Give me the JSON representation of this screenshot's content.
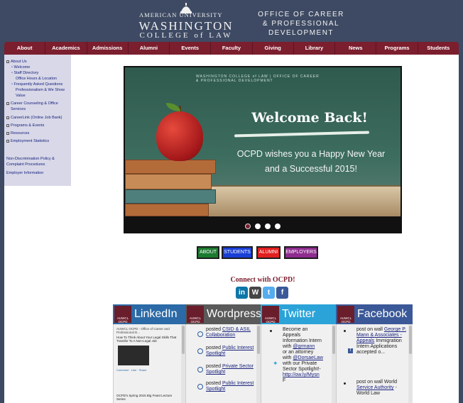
{
  "header": {
    "logo_line1": "AMERICAN UNIVERSITY",
    "logo_line2": "WASHINGTON",
    "logo_line3": "COLLEGE of LAW",
    "office_line1": "OFFICE OF CAREER",
    "office_line2": "& PROFESSIONAL",
    "office_line3": "DEVELOPMENT"
  },
  "nav": [
    "About",
    "Academics",
    "Admissions",
    "Alumni",
    "Events",
    "Faculty",
    "Giving",
    "Library",
    "News",
    "Programs",
    "Students"
  ],
  "sidebar": {
    "items": [
      {
        "label": "About Us"
      },
      {
        "label": "Welcome"
      },
      {
        "label": "Staff Directory"
      },
      {
        "label": "Office Hours & Location"
      },
      {
        "label": "Frequently Asked Questions"
      },
      {
        "label": "Professionalism & We Show"
      },
      {
        "label": "Value"
      },
      {
        "label": "Career Counseling & Office"
      },
      {
        "label": "Services"
      },
      {
        "label": "CareerLink (Online Job Bank)"
      },
      {
        "label": "Programs & Events"
      },
      {
        "label": "Resources"
      },
      {
        "label": "Employment Statistics"
      },
      {
        "label": "Non-Discrimination Policy &"
      },
      {
        "label": "Complaint Procedures"
      },
      {
        "label": "Employer Information"
      }
    ]
  },
  "slider": {
    "mini_logo": "WASHINGTON COLLEGE of LAW  |  OFFICE OF CAREER & PROFESSIONAL DEVELOPMENT",
    "headline": "Welcome Back!",
    "message_line1": "OCPD wishes you a Happy New Year",
    "message_line2": "and a Successful 2015!",
    "active_index": 0,
    "dot_count": 4
  },
  "audience": [
    {
      "label": "ABOUT",
      "color": "#1b7a2f"
    },
    {
      "label": "STUDENTS",
      "color": "#1a3fd6"
    },
    {
      "label": "ALUMNI",
      "color": "#e01f1f"
    },
    {
      "label": "EMPLOYERS",
      "color": "#8e2c8f"
    }
  ],
  "connect": {
    "title": "Connect with OCPD!",
    "icons": [
      "linkedin-icon",
      "wordpress-icon",
      "twitter-icon",
      "facebook-icon"
    ]
  },
  "panels": [
    {
      "title": "LinkedIn",
      "color": "#2b6aa6",
      "badge": "AUWCL OCPD",
      "items": [
        {
          "text": "AUWCL OCPD - Office of Career and Professional D..."
        },
        {
          "text": "How To Think About Your Legal Skills That Transfer To A Non-Legal Job"
        },
        {
          "text": "Comment · Like · Share"
        },
        {
          "text": "OCPD's Spring 2015 Big Feast Lecture Series"
        }
      ]
    },
    {
      "title": "Wordpress",
      "color": "#5a5a5a",
      "badge": "AUWCL OCPD",
      "items": [
        {
          "prefix": "posted ",
          "link": "CSID & ASIL Collaboration"
        },
        {
          "prefix": "posted ",
          "link": "Public Interest Spotlight"
        },
        {
          "prefix": "posted ",
          "link": "Private Sector Spotlight"
        },
        {
          "prefix": "posted ",
          "link": "Public Interest Spotlight"
        }
      ]
    },
    {
      "title": "Twitter",
      "color": "#2ba3d8",
      "badge": "AUWCL OCPD",
      "text_lines": [
        "Become an",
        "Appeals",
        "Information Intern",
        "with",
        "or an attorney",
        "with",
        "with our Private",
        "Sector Spotlight!-",
        "F"
      ],
      "links": [
        "@grmann",
        "@DorsaeLaw",
        "http://ow.ly/Mysn"
      ]
    },
    {
      "title": "Facebook",
      "color": "#3b5998",
      "badge": "AUWCL OCPD",
      "items": [
        {
          "prefix": "post on wall ",
          "link": "George P. Mann & Associates - Appeals",
          "suffix": " Immigration Intern Applications accepted o..."
        },
        {
          "prefix": "post on wall World ",
          "link": "Service Authority",
          "suffix": " - World Law"
        }
      ]
    }
  ]
}
